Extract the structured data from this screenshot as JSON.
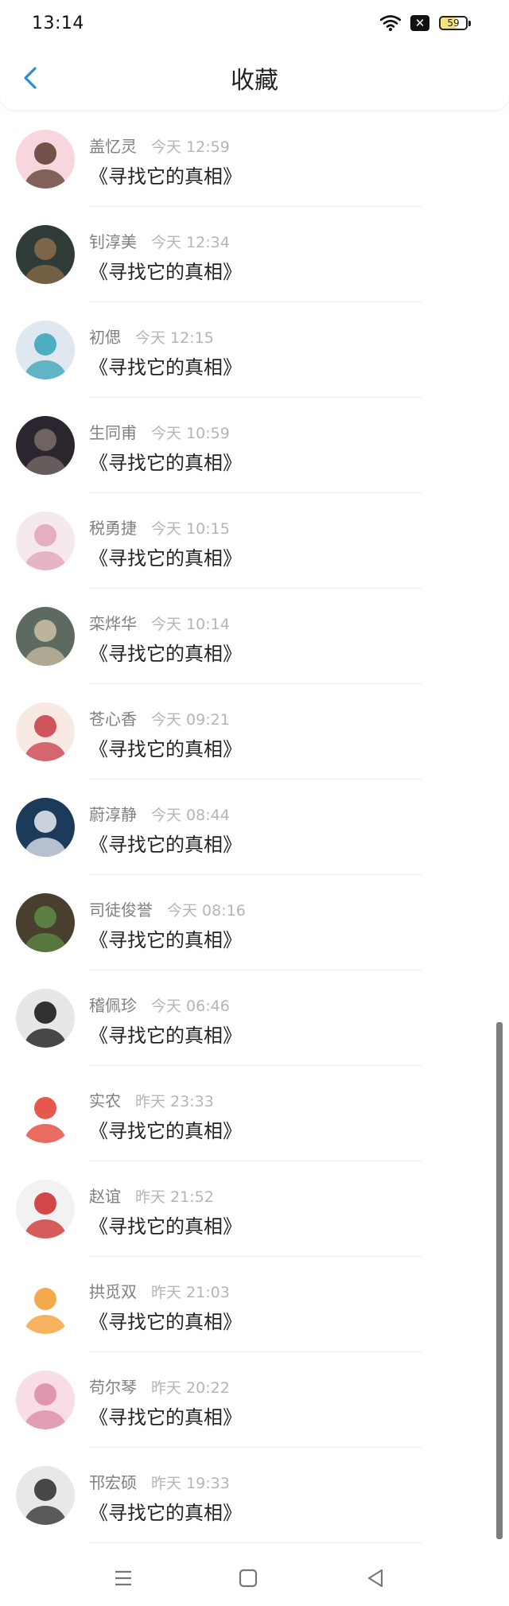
{
  "status": {
    "time": "13:14",
    "battery": "59"
  },
  "header": {
    "title": "收藏"
  },
  "items": [
    {
      "name": "盖忆灵",
      "time": "今天 12:59",
      "content": "《寻找它的真相》",
      "colors": [
        "#f7d6dd",
        "#5b3a2e"
      ]
    },
    {
      "name": "钊淳美",
      "time": "今天 12:34",
      "content": "《寻找它的真相》",
      "colors": [
        "#2f3b36",
        "#8b6d4a"
      ]
    },
    {
      "name": "初偲",
      "time": "今天 12:15",
      "content": "《寻找它的真相》",
      "colors": [
        "#dfe8f0",
        "#35a3b8"
      ]
    },
    {
      "name": "生同甫",
      "time": "今天 10:59",
      "content": "《寻找它的真相》",
      "colors": [
        "#2b2530",
        "#7a6f6a"
      ]
    },
    {
      "name": "税勇捷",
      "time": "今天 10:15",
      "content": "《寻找它的真相》",
      "colors": [
        "#f5e8ef",
        "#e2a3b9"
      ]
    },
    {
      "name": "栾烨华",
      "time": "今天 10:14",
      "content": "《寻找它的真相》",
      "colors": [
        "#5d6a60",
        "#cbbfa5"
      ]
    },
    {
      "name": "苍心香",
      "time": "今天 09:21",
      "content": "《寻找它的真相》",
      "colors": [
        "#f8e9e2",
        "#c83a47"
      ]
    },
    {
      "name": "蔚淳静",
      "time": "今天 08:44",
      "content": "《寻找它的真相》",
      "colors": [
        "#1c3a5a",
        "#e9eef5"
      ]
    },
    {
      "name": "司徒俊誉",
      "time": "今天 08:16",
      "content": "《寻找它的真相》",
      "colors": [
        "#4a3e2f",
        "#5d8b46"
      ]
    },
    {
      "name": "稽佩珍",
      "time": "今天 06:46",
      "content": "《寻找它的真相》",
      "colors": [
        "#e7e7e7",
        "#111111"
      ]
    },
    {
      "name": "实农",
      "time": "昨天 23:33",
      "content": "《寻找它的真相》",
      "colors": [
        "#ffffff",
        "#e23b2f"
      ]
    },
    {
      "name": "赵谊",
      "time": "昨天 21:52",
      "content": "《寻找它的真相》",
      "colors": [
        "#f2f2f2",
        "#cc2a2a"
      ]
    },
    {
      "name": "拱觅双",
      "time": "昨天 21:03",
      "content": "《寻找它的真相》",
      "colors": [
        "#ffffff",
        "#f29a2b"
      ]
    },
    {
      "name": "苟尔琴",
      "time": "昨天 20:22",
      "content": "《寻找它的真相》",
      "colors": [
        "#f8dce6",
        "#d98aa7"
      ]
    },
    {
      "name": "邗宏硕",
      "time": "昨天 19:33",
      "content": "《寻找它的真相》",
      "colors": [
        "#e8e8e8",
        "#2a2a2a"
      ]
    }
  ],
  "icons": {
    "back": "chevron-left-icon",
    "nav": [
      "menu-icon",
      "home-square-icon",
      "back-triangle-icon"
    ]
  }
}
